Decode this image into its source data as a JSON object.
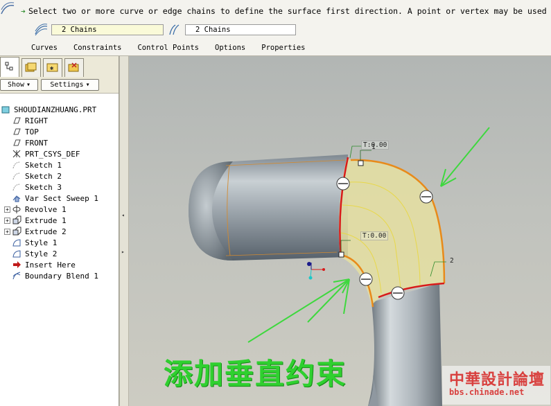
{
  "dashboard": {
    "prompt": "Select two or more curve or edge chains to define the surface first direction. A point or vertex may be used",
    "first_direction_value": "2 Chains",
    "second_direction_value": "2 Chains",
    "slideup_tabs": [
      "Curves",
      "Constraints",
      "Control Points",
      "Options",
      "Properties"
    ]
  },
  "navigator": {
    "tools": {
      "show_label": "Show",
      "settings_label": "Settings"
    },
    "tree": [
      {
        "label": "SHOUDIANZHUANG.PRT",
        "icon": "part-icon",
        "level": 0,
        "expandable": false
      },
      {
        "label": "RIGHT",
        "icon": "datum-plane-icon",
        "level": 1,
        "expandable": false
      },
      {
        "label": "TOP",
        "icon": "datum-plane-icon",
        "level": 1,
        "expandable": false
      },
      {
        "label": "FRONT",
        "icon": "datum-plane-icon",
        "level": 1,
        "expandable": false
      },
      {
        "label": "PRT_CSYS_DEF",
        "icon": "csys-icon",
        "level": 1,
        "expandable": false
      },
      {
        "label": "Sketch 1",
        "icon": "sketch-icon",
        "level": 1,
        "expandable": false
      },
      {
        "label": "Sketch 2",
        "icon": "sketch-icon",
        "level": 1,
        "expandable": false
      },
      {
        "label": "Sketch 3",
        "icon": "sketch-icon",
        "level": 1,
        "expandable": false
      },
      {
        "label": "Var Sect Sweep 1",
        "icon": "sweep-icon",
        "level": 1,
        "expandable": false
      },
      {
        "label": "Revolve 1",
        "icon": "revolve-icon",
        "level": 1,
        "expandable": true
      },
      {
        "label": "Extrude 1",
        "icon": "extrude-icon",
        "level": 1,
        "expandable": true
      },
      {
        "label": "Extrude 2",
        "icon": "extrude-icon",
        "level": 1,
        "expandable": true
      },
      {
        "label": "Style 1",
        "icon": "style-icon",
        "level": 1,
        "expandable": false
      },
      {
        "label": "Style 2",
        "icon": "style-icon",
        "level": 1,
        "expandable": false
      },
      {
        "label": "Insert Here",
        "icon": "insert-arrow-icon",
        "level": 1,
        "expandable": false
      },
      {
        "label": "Boundary Blend 1",
        "icon": "boundary-blend-icon",
        "level": 1,
        "expandable": false
      }
    ]
  },
  "viewport": {
    "constraint_label_1": "T:0.00",
    "constraint_label_2": "T:0.00",
    "chain_number_1": "1",
    "chain_number_2": "2",
    "annotation_text": "添加垂直约束",
    "watermark_top": "中華設計論壇",
    "watermark_bottom": "bbs.chinade.net"
  },
  "colors": {
    "annotation": "#2fd02f",
    "selected_edge": "#e88a1a",
    "boundary_edge_red": "#d81a1a",
    "surface_fill": "#e6e0a0",
    "watermark": "#d8403e"
  }
}
